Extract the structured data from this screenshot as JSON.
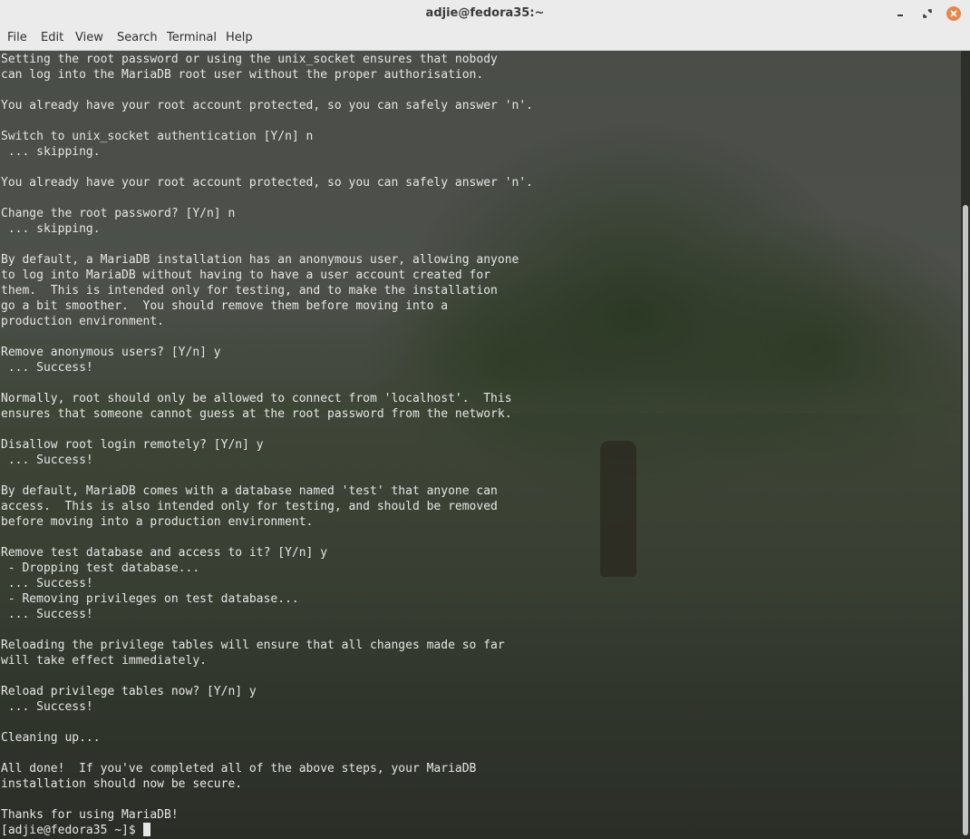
{
  "window": {
    "title": "adjie@fedora35:~",
    "controls": {
      "minimize_icon": "minimize-icon",
      "maximize_icon": "maximize-icon",
      "close_icon": "close-icon",
      "close_color": "#e5874c"
    }
  },
  "menubar": {
    "items": [
      "File",
      "Edit",
      "View",
      "Search",
      "Terminal",
      "Help"
    ]
  },
  "terminal": {
    "lines": [
      "Setting the root password or using the unix_socket ensures that nobody",
      "can log into the MariaDB root user without the proper authorisation.",
      "",
      "You already have your root account protected, so you can safely answer 'n'.",
      "",
      "Switch to unix_socket authentication [Y/n] n",
      " ... skipping.",
      "",
      "You already have your root account protected, so you can safely answer 'n'.",
      "",
      "Change the root password? [Y/n] n",
      " ... skipping.",
      "",
      "By default, a MariaDB installation has an anonymous user, allowing anyone",
      "to log into MariaDB without having to have a user account created for",
      "them.  This is intended only for testing, and to make the installation",
      "go a bit smoother.  You should remove them before moving into a",
      "production environment.",
      "",
      "Remove anonymous users? [Y/n] y",
      " ... Success!",
      "",
      "Normally, root should only be allowed to connect from 'localhost'.  This",
      "ensures that someone cannot guess at the root password from the network.",
      "",
      "Disallow root login remotely? [Y/n] y",
      " ... Success!",
      "",
      "By default, MariaDB comes with a database named 'test' that anyone can",
      "access.  This is also intended only for testing, and should be removed",
      "before moving into a production environment.",
      "",
      "Remove test database and access to it? [Y/n] y",
      " - Dropping test database...",
      " ... Success!",
      " - Removing privileges on test database...",
      " ... Success!",
      "",
      "Reloading the privilege tables will ensure that all changes made so far",
      "will take effect immediately.",
      "",
      "Reload privilege tables now? [Y/n] y",
      " ... Success!",
      "",
      "Cleaning up...",
      "",
      "All done!  If you've completed all of the above steps, your MariaDB",
      "installation should now be secure.",
      "",
      "Thanks for using MariaDB!"
    ],
    "prompt": "[adjie@fedora35 ~]$ "
  },
  "colors": {
    "titlebar_bg": "#ebebeb",
    "terminal_fg": "#e6e6e6"
  }
}
